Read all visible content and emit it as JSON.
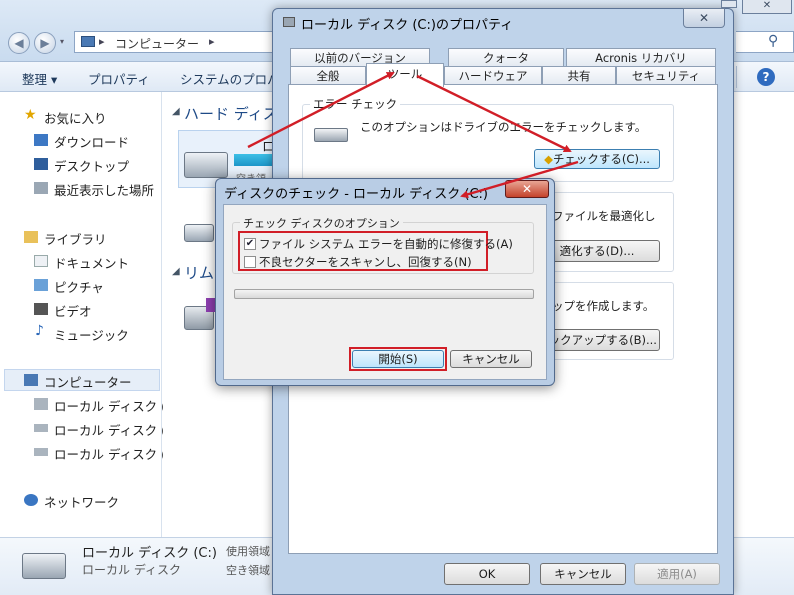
{
  "explorer": {
    "breadcrumb": "コンピューター",
    "toolbar": {
      "organize": "整理 ▾",
      "properties": "プロパティ",
      "system": "システムのプロパ"
    },
    "content": {
      "hard_disk_heading": "ハード ディス",
      "removable_heading": "リム",
      "drive_label_fragment": "ロー",
      "drive_sub_fragment": "空き領"
    },
    "sidebar": {
      "favorites": "お気に入り",
      "favorites_items": [
        "ダウンロード",
        "デスクトップ",
        "最近表示した場所"
      ],
      "libraries": "ライブラリ",
      "library_items": [
        "ドキュメント",
        "ピクチャ",
        "ビデオ",
        "ミュージック"
      ],
      "computer": "コンピューター",
      "computer_items": [
        "ローカル ディスク (",
        "ローカル ディスク (",
        "ローカル ディスク ("
      ],
      "network": "ネットワーク"
    },
    "details": {
      "name": "ローカル ディスク (C:)",
      "type": "ローカル ディスク",
      "used_label": "使用領域",
      "free_label": "空き領域"
    }
  },
  "properties_dialog": {
    "title": "ローカル ディスク (C:)のプロパティ",
    "tabs_row1": [
      "以前のバージョン",
      "クォータ",
      "Acronis リカバリ"
    ],
    "tabs_row2": [
      "全般",
      "ツール",
      "ハードウェア",
      "共有",
      "セキュリティ"
    ],
    "error_check": {
      "heading": "エラー チェック",
      "description": "このオプションはドライブのエラーをチェックします。",
      "button": "チェックする(C)..."
    },
    "defrag": {
      "description_fragment": "ファイルを最適化し",
      "button": "適化する(D)..."
    },
    "backup": {
      "description_fragment": "ップを作成します。",
      "button": "バックアップする(B)..."
    },
    "buttons": {
      "ok": "OK",
      "cancel": "キャンセル",
      "apply": "適用(A)"
    }
  },
  "check_disk_dialog": {
    "title": "ディスクのチェック - ローカル ディスク (C:)",
    "options_heading": "チェック ディスクのオプション",
    "option1": {
      "label": "ファイル システム エラーを自動的に修復する(A)",
      "checked": true
    },
    "option2": {
      "label": "不良セクターをスキャンし、回復する(N)",
      "checked": false
    },
    "progress": 0,
    "start_button": "開始(S)",
    "cancel_button": "キャンセル"
  },
  "colors": {
    "annotation_red": "#d11e27",
    "window_frame": "#bfd3ea"
  }
}
